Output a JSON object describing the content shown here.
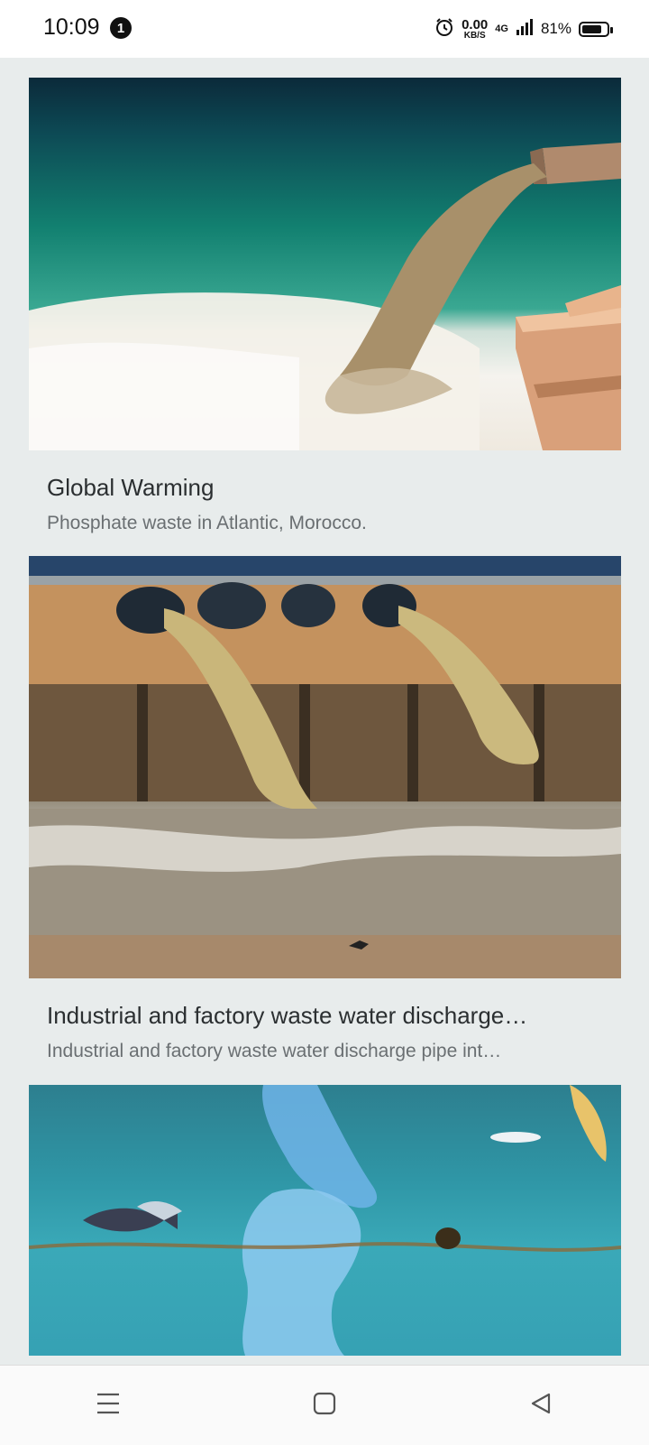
{
  "status_bar": {
    "time": "10:09",
    "notification_count": "1",
    "speed_value": "0.00",
    "speed_unit": "KB/S",
    "network": "4G",
    "battery_percent": "81%",
    "battery_level": 0.81,
    "icons": [
      "alarm-icon",
      "signal-icon",
      "battery-icon"
    ]
  },
  "cards": [
    {
      "title": "Global Warming",
      "subtitle": "Phosphate waste in Atlantic, Morocco.",
      "image": "ocean-waste-pipe-photo"
    },
    {
      "title": "Industrial and factory waste water discharge…",
      "subtitle": "Industrial and factory waste water discharge pipe int…",
      "image": "factory-discharge-photo"
    },
    {
      "title": "",
      "subtitle": "",
      "image": "underwater-plastic-photo"
    }
  ],
  "nav": {
    "icons": [
      "menu-icon",
      "home-square-icon",
      "back-triangle-icon"
    ]
  }
}
